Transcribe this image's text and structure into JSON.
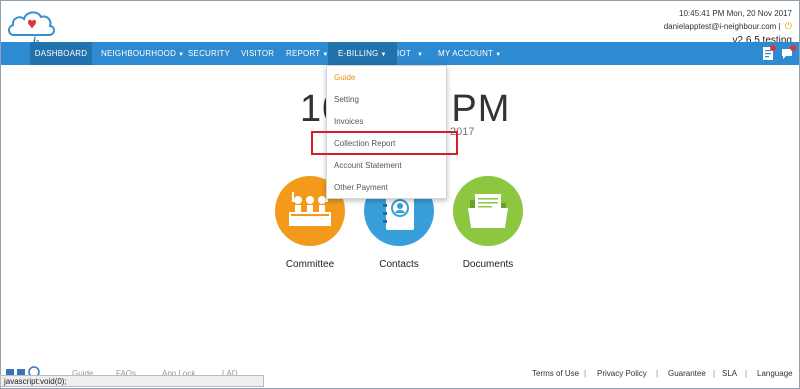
{
  "brand": {
    "logo_text": "i-Neighbour"
  },
  "header": {
    "time": "10:45:41 PM",
    "date": "Mon, 20 Nov 2017",
    "email": "danielapptest@i-neighbour.com",
    "separator": "|",
    "version": "v2.6.5 testing"
  },
  "nav": {
    "items": [
      {
        "label": "DASHBOARD",
        "caret": false
      },
      {
        "label": "NEIGHBOURHOOD",
        "caret": true
      },
      {
        "label": "SECURITY",
        "caret": false
      },
      {
        "label": "VISITOR",
        "caret": false
      },
      {
        "label": "REPORT",
        "caret": true
      },
      {
        "label": "E-BILLING",
        "caret": true
      },
      {
        "label": "IOT",
        "caret": true
      },
      {
        "label": "MY ACCOUNT",
        "caret": true
      }
    ],
    "caret_glyph": "▼"
  },
  "dropdown": {
    "items": [
      "Guide",
      "Setting",
      "Invoices",
      "Collection Report",
      "Account Statement",
      "Other Payment"
    ]
  },
  "clock": {
    "left": "10",
    "right": "PM",
    "date_tail": "2017"
  },
  "tiles": [
    {
      "label": "Committee",
      "color": "#f39a1c",
      "icon": "committee-icon"
    },
    {
      "label": "Contacts",
      "color": "#37a0da",
      "icon": "contacts-icon"
    },
    {
      "label": "Documents",
      "color": "#8dc63f",
      "icon": "documents-icon"
    }
  ],
  "footer": {
    "left_links": [
      "Guide",
      "FAQs",
      "App Lock",
      "LAD"
    ],
    "right_links": [
      "Terms of Use",
      "Privacy Policy",
      "Guarantee",
      "SLA",
      "Language"
    ],
    "sep": "|",
    "status_text": "javascript:void(0);"
  }
}
